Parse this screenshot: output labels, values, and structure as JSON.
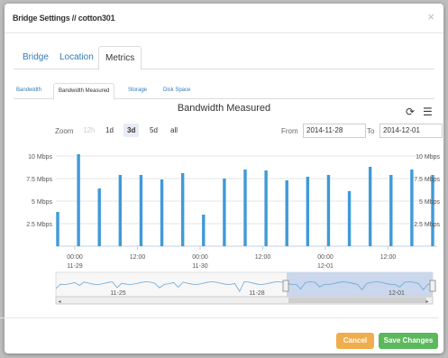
{
  "modal": {
    "title": "Bridge Settings // cotton301",
    "close_icon": "×"
  },
  "main_tabs": [
    {
      "label": "Bridge"
    },
    {
      "label": "Location"
    },
    {
      "label": "Metrics"
    }
  ],
  "sub_tabs": [
    {
      "label": "Bandwidth"
    },
    {
      "label": "Bandwidth Measured"
    },
    {
      "label": "Storage"
    },
    {
      "label": "Disk Space"
    }
  ],
  "chart_toolbar": {
    "refresh_icon": "⟳",
    "menu_icon": "☰",
    "zoom_label": "Zoom",
    "zoom_options": [
      "12h",
      "1d",
      "3d",
      "5d",
      "all"
    ],
    "zoom_selected": "3d",
    "from_label": "From",
    "from_value": "2014-11-28",
    "to_label": "To",
    "to_value": "2014-12-01"
  },
  "chart_data": {
    "type": "bar",
    "title": "Bandwidth Measured",
    "yticks": [
      "10 Mbps",
      "7.5 Mbps",
      "5 Mbps",
      "2.5 Mbps"
    ],
    "ylim": [
      0,
      11
    ],
    "xticks": [
      {
        "time": "00:00",
        "date": "11-29"
      },
      {
        "time": "12:00",
        "date": ""
      },
      {
        "time": "00:00",
        "date": "11-30"
      },
      {
        "time": "12:00",
        "date": ""
      },
      {
        "time": "00:00",
        "date": "12-01"
      },
      {
        "time": "12:00",
        "date": ""
      }
    ],
    "values": [
      3.8,
      10.2,
      6.4,
      7.9,
      7.9,
      7.4,
      8.1,
      3.5,
      7.5,
      8.5,
      8.4,
      7.3,
      7.7,
      7.9,
      6.1,
      8.8,
      7.9,
      8.5,
      7.9
    ],
    "color": "#3f9ad8",
    "grid": true
  },
  "navigator": {
    "labels": [
      "11-25",
      "11-28",
      "12-01"
    ],
    "series_color": "#3f9ad8"
  },
  "footer": {
    "cancel_label": "Cancel",
    "save_label": "Save Changes"
  },
  "colors": {
    "cancel": "#f0ad4e",
    "save": "#5cb85c",
    "link": "#337ab7"
  }
}
